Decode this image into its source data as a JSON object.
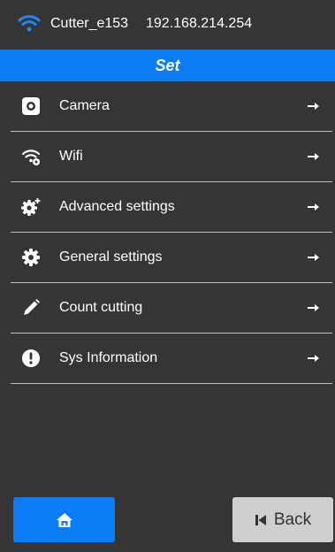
{
  "status_bar": {
    "device_name": "Cutter_e153",
    "ip_address": "192.168.214.254",
    "wifi_icon": "wifi-signal-icon"
  },
  "header": {
    "title": "Set"
  },
  "menu": {
    "items": [
      {
        "label": "Camera",
        "icon": "camera-icon"
      },
      {
        "label": "Wifi",
        "icon": "wifi-settings-icon"
      },
      {
        "label": "Advanced settings",
        "icon": "advanced-gear-icon"
      },
      {
        "label": "General settings",
        "icon": "gear-icon"
      },
      {
        "label": "Count cutting",
        "icon": "pencil-icon"
      },
      {
        "label": "Sys Information",
        "icon": "exclamation-icon"
      }
    ],
    "arrow_icon": "arrow-right-icon"
  },
  "footer": {
    "home_icon": "home-icon",
    "back_label": "Back",
    "back_icon": "skip-back-icon"
  },
  "colors": {
    "background": "#353535",
    "accent": "#0a7df5",
    "back_button": "#cfcfcf",
    "divider": "#bdbdbd"
  }
}
